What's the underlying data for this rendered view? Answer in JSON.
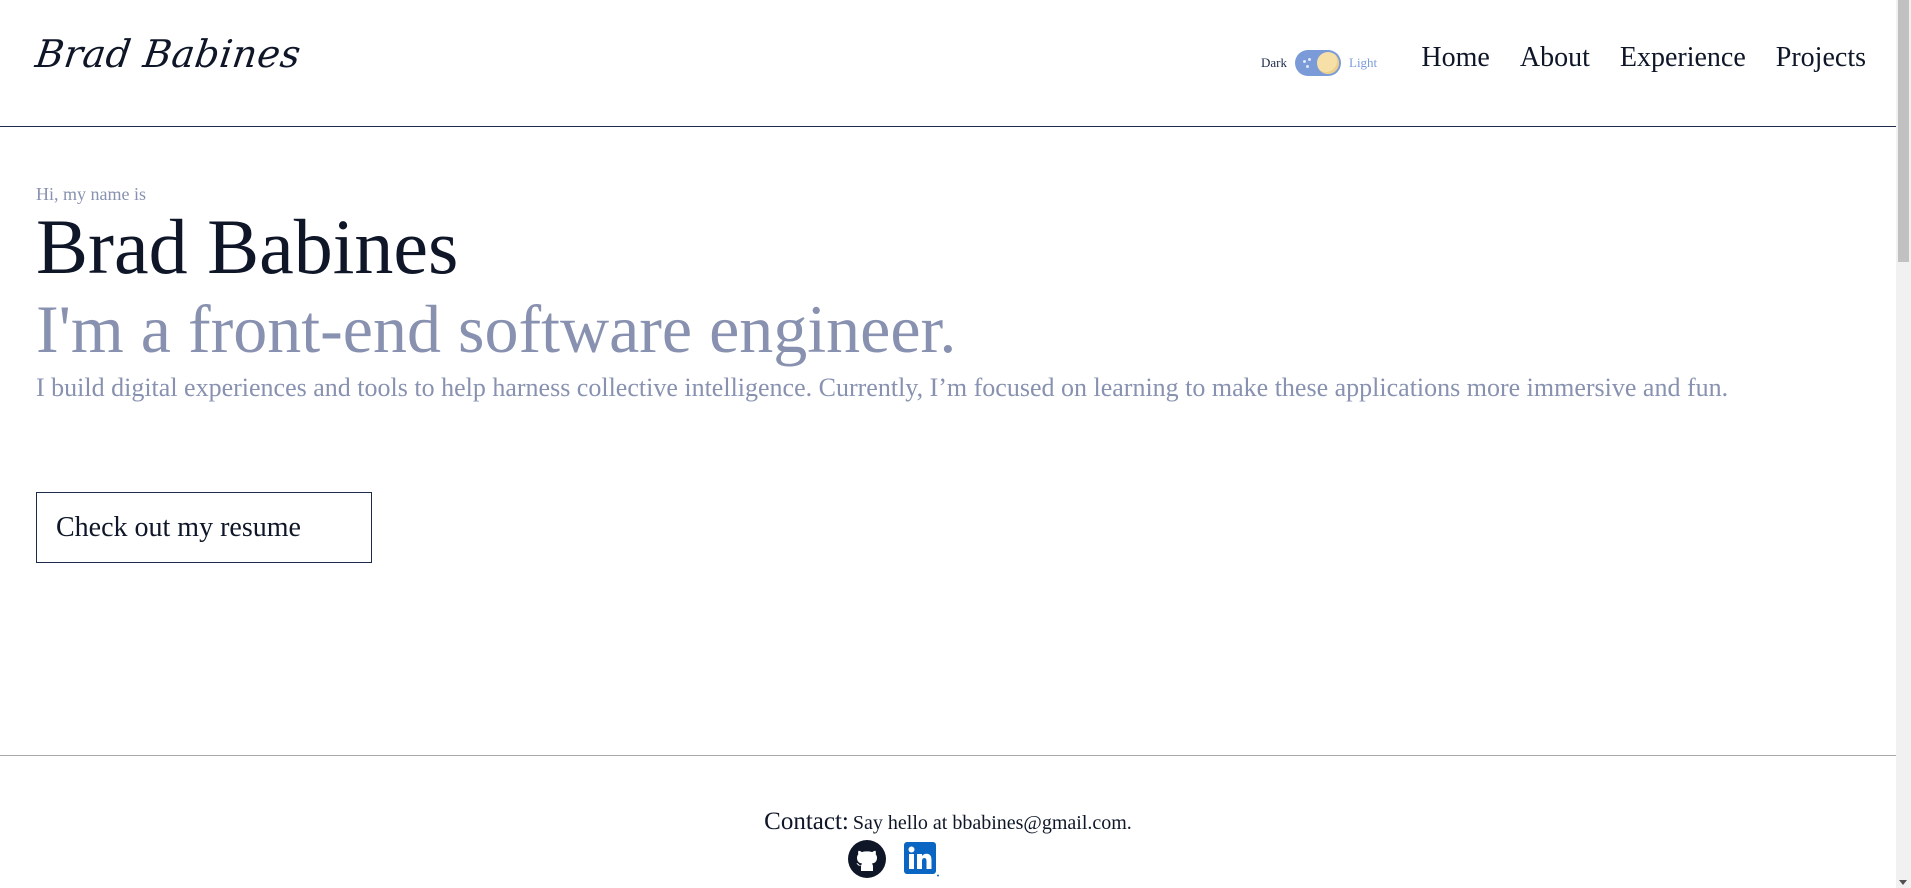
{
  "header": {
    "logo": "Brad Babines",
    "theme_toggle": {
      "dark_label": "Dark",
      "light_label": "Light",
      "state": "light"
    },
    "nav": [
      {
        "label": "Home"
      },
      {
        "label": "About"
      },
      {
        "label": "Experience"
      },
      {
        "label": "Projects"
      }
    ]
  },
  "hero": {
    "intro": "Hi, my name is",
    "name": "Brad Babines",
    "tagline": "I'm a front-end software engineer.",
    "bio": "I build digital experiences and tools to help harness collective intelligence. Currently, I’m focused on learning to make these applications more immersive and fun.",
    "resume_button": "Check out my resume"
  },
  "footer": {
    "contact_label": "Contact:",
    "contact_text": "Say hello at bbabines@gmail.com.",
    "social": [
      {
        "icon": "github-icon"
      },
      {
        "icon": "linkedin-icon"
      }
    ]
  },
  "colors": {
    "primary_text": "#0e1628",
    "muted_text": "#8892b0",
    "toggle_accent": "#7b9bd8",
    "linkedin_blue": "#0a66c2"
  }
}
